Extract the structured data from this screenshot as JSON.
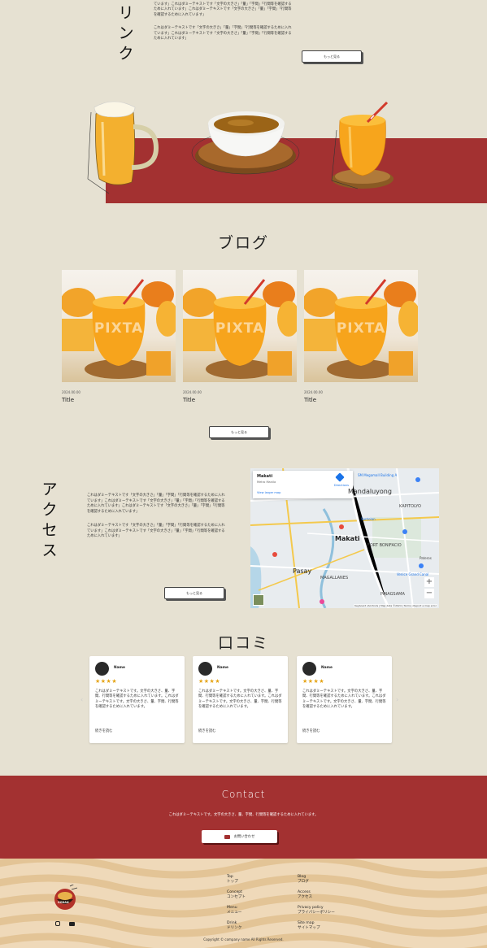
{
  "link_section": {
    "title": "リンク",
    "paragraph1": "これはダミーテキストです「文字の大きさ」「量」「字間」「行間等を確認するために入れています」これはダミーテキストです「文字の大きさ」「量」「字間」「行間等を確認するために入れています」これはダミーテキストです「文字の大きさ」「量」「字間」「行間等を確認するために入れています」",
    "paragraph2": "これはダミーテキストです「文字の大きさ」「量」「字間」「行間等を確認するために入れています」これはダミーテキストです「文字の大きさ」「量」「字間」「行間等を確認するために入れています」",
    "more_button": "もっと見る"
  },
  "blog": {
    "heading": "ブログ",
    "watermark": "PIXTA",
    "posts": [
      {
        "date": "2024.00.00",
        "title": "Title"
      },
      {
        "date": "2024.00.00",
        "title": "Title"
      },
      {
        "date": "2024.00.00",
        "title": "Title"
      }
    ],
    "more_button": "もっと見る"
  },
  "access": {
    "title": "アクセス",
    "paragraph1": "これはダミーテキストです「文字の大きさ」「量」「字間」「行間等を確認するために入れています」これはダミーテキストです「文字の大きさ」「量」「字間」「行間等を確認するために入れています」これはダミーテキストです「文字の大きさ」「量」「字間」「行間等を確認するために入れています」",
    "paragraph2": "これはダミーテキストです「文字の大きさ」「量」「字間」「行間等を確認するために入れています」これはダミーテキストです「文字の大きさ」「量」「字間」「行間等を確認するために入れています」",
    "more_button": "もっと見る",
    "map": {
      "place_name": "Makati",
      "place_sub": "Metro Manila",
      "directions": "Directions",
      "larger_map": "View larger map",
      "labels": [
        "Mandaluyong",
        "SM Megamall Building A",
        "KAPITOLYO",
        "Makati",
        "FORT BONIFACIO",
        "Pasay",
        "MAGALLANES",
        "PINAGSAMA",
        "Pateros",
        "Santolan",
        "Venice Grand Canal"
      ],
      "attribution": "Keyboard shortcuts | Map data ©2024 | Terms | Report a map error"
    }
  },
  "reviews": {
    "heading": "口コミ",
    "items": [
      {
        "name": "Name",
        "stars": "★★★★",
        "text": "これはダミーテキストです。文字の大きさ、量、字間、行間等を確認するために入れています。これはダミーテキストです。文字の大きさ、量、字間、行間等を確認するために入れています。",
        "more": "続きを読む"
      },
      {
        "name": "Name",
        "stars": "★★★★",
        "text": "これはダミーテキストです。文字の大きさ、量、字間、行間等を確認するために入れています。これはダミーテキストです。文字の大きさ、量、字間、行間等を確認するために入れています。",
        "more": "続きを読む"
      },
      {
        "name": "Name",
        "stars": "★★★★",
        "text": "これはダミーテキストです。文字の大きさ、量、字間、行間等を確認するために入れています。これはダミーテキストです。文字の大きさ、量、字間、行間等を確認するために入れています。",
        "more": "続きを読む"
      }
    ]
  },
  "contact": {
    "heading": "Contact",
    "text": "これはダミーテキストです。文字の大きさ、量、字間、行間等を確認するために入れています。",
    "button": "お問い合わせ"
  },
  "footer": {
    "logo_text": "GOHAN",
    "nav_col1": [
      {
        "en": "Top",
        "ja": "トップ"
      },
      {
        "en": "Concept",
        "ja": "コンセプト"
      },
      {
        "en": "Menu",
        "ja": "メニュー"
      },
      {
        "en": "Drink",
        "ja": "ドリンク"
      }
    ],
    "nav_col2": [
      {
        "en": "Blog",
        "ja": "ブログ"
      },
      {
        "en": "Access",
        "ja": "アクセス"
      },
      {
        "en": "Privacy policy",
        "ja": "プライバシーポリシー"
      },
      {
        "en": "Site map",
        "ja": "サイトマップ"
      }
    ],
    "copyright": "Copyright © company name All Rights Reserved."
  },
  "colors": {
    "background": "#e6e1d2",
    "accent_red": "#a33131",
    "footer_bg": "#efd9b9",
    "star": "#e5a415"
  }
}
